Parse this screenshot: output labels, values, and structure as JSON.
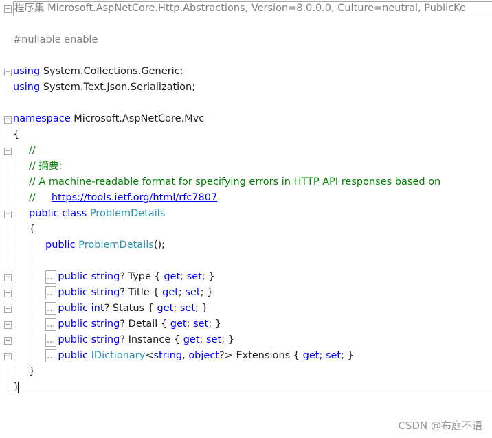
{
  "header": {
    "text": "程序集 Microsoft.AspNetCore.Http.Abstractions, Version=8.0.0.0, Culture=neutral, PublicKe"
  },
  "code": {
    "pragma": "#nullable enable",
    "using1": {
      "kw": "using",
      "rest": " System.Collections.Generic;"
    },
    "using2": {
      "kw": "using",
      "rest": " System.Text.Json.Serialization;"
    },
    "ns": {
      "kw": "namespace",
      "rest": " Microsoft.AspNetCore.Mvc"
    },
    "ns_open": "{",
    "cm1": "//",
    "cm2": "// 摘要:",
    "cm3": "//     A machine-readable format for specifying errors in HTTP API responses based on",
    "cm4a": "//     ",
    "cm4link": "https://tools.ietf.org/html/rfc7807",
    "cm4b": ".",
    "class_kw": "public class",
    "class_name": "ProblemDetails",
    "class_open": "{",
    "ctor_kw": "public",
    "ctor_name": "ProblemDetails",
    "ctor_rest": "();",
    "fold_label": "...",
    "props": [
      {
        "kw1": "public",
        "type": "string",
        "rest": "? Type { ",
        "get": "get",
        "sep": "; ",
        "set": "set",
        "end": "; }"
      },
      {
        "kw1": "public",
        "type": "string",
        "rest": "? Title { ",
        "get": "get",
        "sep": "; ",
        "set": "set",
        "end": "; }"
      },
      {
        "kw1": "public",
        "type": "int",
        "rest": "? Status { ",
        "get": "get",
        "sep": "; ",
        "set": "set",
        "end": "; }"
      },
      {
        "kw1": "public",
        "type": "string",
        "rest": "? Detail { ",
        "get": "get",
        "sep": "; ",
        "set": "set",
        "end": "; }"
      },
      {
        "kw1": "public",
        "type": "string",
        "rest": "? Instance { ",
        "get": "get",
        "sep": "; ",
        "set": "set",
        "end": "; }"
      }
    ],
    "prop_ext": {
      "kw1": "public",
      "type": "IDictionary",
      "lt": "<",
      "t1": "string",
      "comma": ", ",
      "t2": "object",
      "rest": "?> Extensions { ",
      "get": "get",
      "sep": "; ",
      "set": "set",
      "end": "; }"
    },
    "class_close": "}",
    "ns_close": "}"
  },
  "watermark": "CSDN @布庭不语"
}
